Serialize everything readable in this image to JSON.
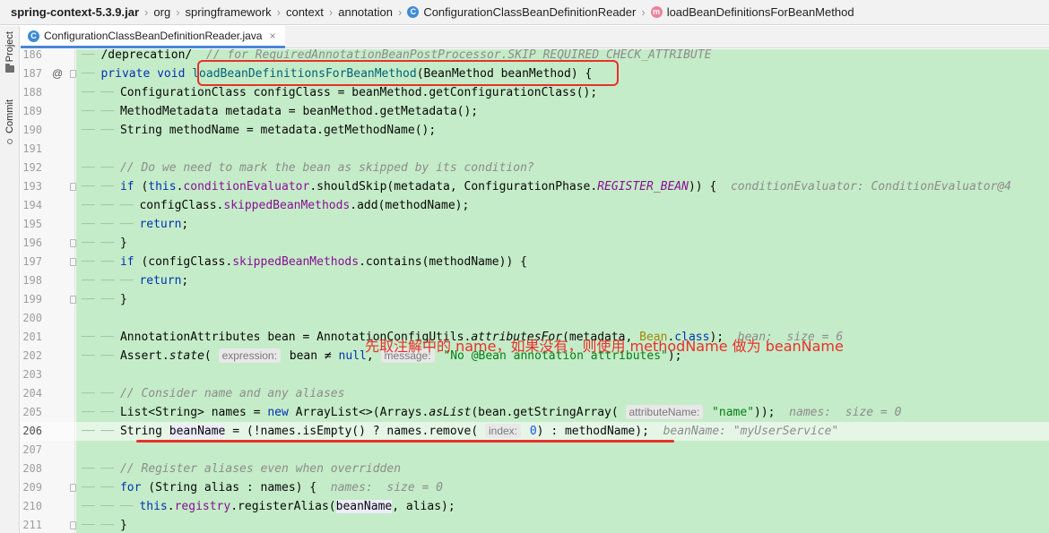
{
  "breadcrumb": {
    "items": [
      "spring-context-5.3.9.jar",
      "org",
      "springframework",
      "context",
      "annotation",
      "ConfigurationClassBeanDefinitionReader",
      "loadBeanDefinitionsForBeanMethod"
    ],
    "separator": "›"
  },
  "tool_strip": {
    "project_label": "Project",
    "commit_label": "Commit"
  },
  "tab": {
    "label": "ConfigurationClassBeanDefinitionReader.java",
    "close": "×"
  },
  "gutter": {
    "override_marker": "@"
  },
  "annotation_note": "先取注解中的 name，如果没有，则使用 methodName 做为 beanName",
  "colors": {
    "annotation_red": "#e8302c",
    "diff_green": "#c5ecc8",
    "keyword": "#0033b3"
  },
  "lines": {
    "l186": {
      "num": "186",
      "t1": "/deprecation/  ",
      "t2": "// for RequiredAnnotationBeanPostProcessor.SKIP_REQUIRED_CHECK_ATTRIBUTE"
    },
    "l187": {
      "num": "187",
      "kw": "private void ",
      "fn": "loadBeanDefinitionsForBeanMethod",
      "rest": "(BeanMethod beanMethod) {"
    },
    "l188": {
      "num": "188",
      "text": "ConfigurationClass configClass = beanMethod.getConfigurationClass();"
    },
    "l189": {
      "num": "189",
      "text": "MethodMetadata metadata = beanMethod.getMetadata();"
    },
    "l190": {
      "num": "190",
      "text": "String methodName = metadata.getMethodName();"
    },
    "l191": {
      "num": "191"
    },
    "l192": {
      "num": "192",
      "comment": "// Do we need to mark the bean as skipped by its condition?"
    },
    "l193": {
      "num": "193",
      "kw_if": "if",
      "a": " (",
      "kw_this": "this",
      "b": ".",
      "fld": "conditionEvaluator",
      "c": ".shouldSkip(metadata, ConfigurationPhase.",
      "stat": "REGISTER_BEAN",
      "d": ")) {",
      "inline": "conditionEvaluator: ConditionEvaluator@4"
    },
    "l194": {
      "num": "194",
      "a": "configClass.",
      "fld": "skippedBeanMethods",
      "b": ".add(methodName);"
    },
    "l195": {
      "num": "195",
      "kw": "return",
      "a": ";"
    },
    "l196": {
      "num": "196",
      "text": "}"
    },
    "l197": {
      "num": "197",
      "kw_if": "if",
      "a": " (configClass.",
      "fld": "skippedBeanMethods",
      "b": ".contains(methodName)) {"
    },
    "l198": {
      "num": "198",
      "kw": "return",
      "a": ";"
    },
    "l199": {
      "num": "199",
      "text": "}"
    },
    "l200": {
      "num": "200"
    },
    "l201": {
      "num": "201",
      "a": "AnnotationAttributes bean = AnnotationConfigUtils.",
      "sm": "attributesFor",
      "b": "(metadata, ",
      "ann": "Bean",
      "c": ".",
      "kw": "class",
      "d": ");",
      "inline": "bean:  size = 6"
    },
    "l202": {
      "num": "202",
      "a": "Assert.",
      "sm": "state",
      "b": "( ",
      "hint1": "expression:",
      "c": " bean ",
      "ne": "≠",
      "kw_null": " null",
      "d": ", ",
      "hint2": "message:",
      "str": " \"No @Bean annotation attributes\"",
      "e": ");"
    },
    "l203": {
      "num": "203"
    },
    "l204": {
      "num": "204",
      "comment": "// Consider name and any aliases"
    },
    "l205": {
      "num": "205",
      "a": "List<String> names = ",
      "kw_new": "new",
      "b": " ArrayList<>(Arrays.",
      "sm": "asList",
      "c": "(bean.getStringArray( ",
      "hint": "attributeName:",
      "str": " \"name\"",
      "d": "));",
      "inline": "names:  size = 0"
    },
    "l206": {
      "num": "206",
      "a": "String ",
      "var": "beanName",
      "b": " = (!names.isEmpty() ? names.remove( ",
      "hint": "index:",
      "num0": " 0",
      "c": ") : methodName);",
      "inline": "beanName: \"myUserService\""
    },
    "l207": {
      "num": "207"
    },
    "l208": {
      "num": "208",
      "comment": "// Register aliases even when overridden"
    },
    "l209": {
      "num": "209",
      "kw_for": "for",
      "a": " (String alias : names) {",
      "inline": "names:  size = 0"
    },
    "l210": {
      "num": "210",
      "kw_this": "this",
      "a": ".",
      "fld": "registry",
      "b": ".registerAlias(",
      "var": "beanName",
      "c": ", alias);"
    },
    "l211": {
      "num": "211",
      "text": "}"
    }
  }
}
